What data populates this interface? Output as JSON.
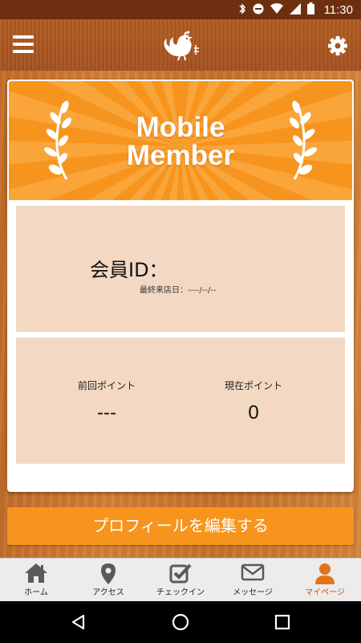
{
  "status_bar": {
    "time": "11:30",
    "icons": [
      "bluetooth-icon",
      "do-not-disturb-icon",
      "wifi-icon",
      "signal-icon",
      "battery-icon"
    ]
  },
  "app_bar": {
    "menu_icon": "hamburger-menu-icon",
    "logo_icon": "rooster-logo-icon",
    "settings_icon": "gear-icon"
  },
  "card": {
    "banner_title_line1": "Mobile",
    "banner_title_line2": "Member",
    "member_id_label": "会員ID：",
    "last_visit_label": "最終来店日：----/--/--",
    "prev_points_label": "前回ポイント",
    "prev_points_value": "---",
    "current_points_label": "現在ポイント",
    "current_points_value": "0"
  },
  "edit_profile_label": "プロフィールを編集する",
  "tabs": [
    {
      "label": "ホーム",
      "icon": "home-icon"
    },
    {
      "label": "アクセス",
      "icon": "map-pin-icon"
    },
    {
      "label": "チェックイン",
      "icon": "checkbox-icon"
    },
    {
      "label": "メッセージ",
      "icon": "envelope-icon"
    },
    {
      "label": "マイページ",
      "icon": "person-icon",
      "active": true
    }
  ],
  "colors": {
    "accent": "#f7941e",
    "active_tab": "#c4500d",
    "panel": "#f3d9c3"
  }
}
